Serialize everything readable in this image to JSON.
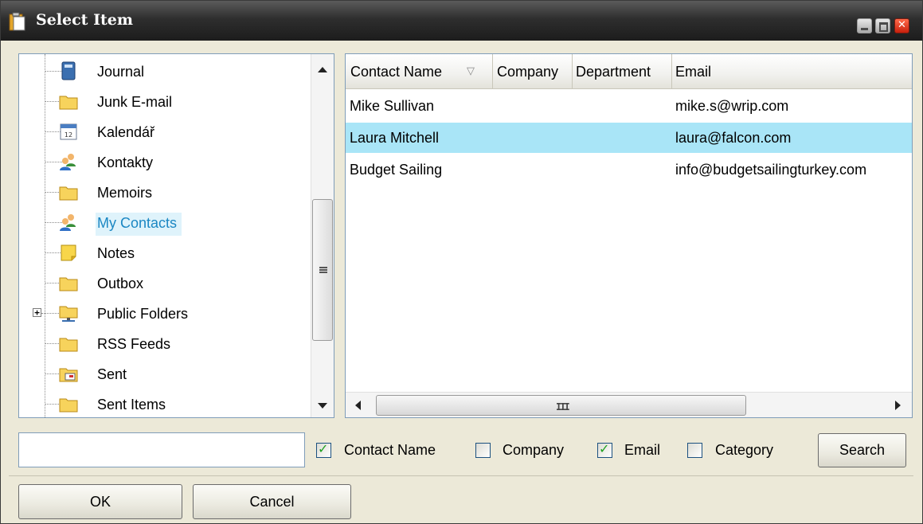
{
  "window": {
    "title": "Select Item"
  },
  "tree": {
    "items": [
      {
        "label": "Journal",
        "icon": "journal-icon"
      },
      {
        "label": "Junk E-mail",
        "icon": "folder-icon"
      },
      {
        "label": "Kalendář",
        "icon": "calendar-icon"
      },
      {
        "label": "Kontakty",
        "icon": "contacts-icon"
      },
      {
        "label": "Memoirs",
        "icon": "folder-icon"
      },
      {
        "label": "My Contacts",
        "icon": "contacts-icon",
        "selected": true
      },
      {
        "label": "Notes",
        "icon": "notes-icon"
      },
      {
        "label": "Outbox",
        "icon": "folder-icon"
      },
      {
        "label": "Public Folders",
        "icon": "public-folder-icon",
        "expandable": true
      },
      {
        "label": "RSS Feeds",
        "icon": "folder-icon"
      },
      {
        "label": "Sent",
        "icon": "sent-icon"
      },
      {
        "label": "Sent Items",
        "icon": "folder-icon"
      }
    ]
  },
  "grid": {
    "columns": [
      "Contact Name",
      "Company",
      "Department",
      "Email"
    ],
    "sort_glyph": "▽",
    "rows": [
      {
        "contact_name": "Mike Sullivan",
        "company": "",
        "department": "",
        "email": "mike.s@wrip.com"
      },
      {
        "contact_name": "Laura Mitchell",
        "company": "",
        "department": "",
        "email": "laura@falcon.com",
        "selected": true
      },
      {
        "contact_name": "Budget Sailing",
        "company": "",
        "department": "",
        "email": "info@budgetsailingturkey.com"
      }
    ],
    "hscroll_grip": "III"
  },
  "search": {
    "value": "",
    "filters": [
      {
        "label": "Contact Name",
        "checked": true
      },
      {
        "label": "Company",
        "checked": false
      },
      {
        "label": "Email",
        "checked": true
      },
      {
        "label": "Category",
        "checked": false
      }
    ],
    "button_label": "Search"
  },
  "footer": {
    "ok_label": "OK",
    "cancel_label": "Cancel"
  },
  "colors": {
    "selection_bg": "#a9e5f7",
    "tree_selection_text": "#1b87c3",
    "dialog_bg": "#ece9d8"
  }
}
